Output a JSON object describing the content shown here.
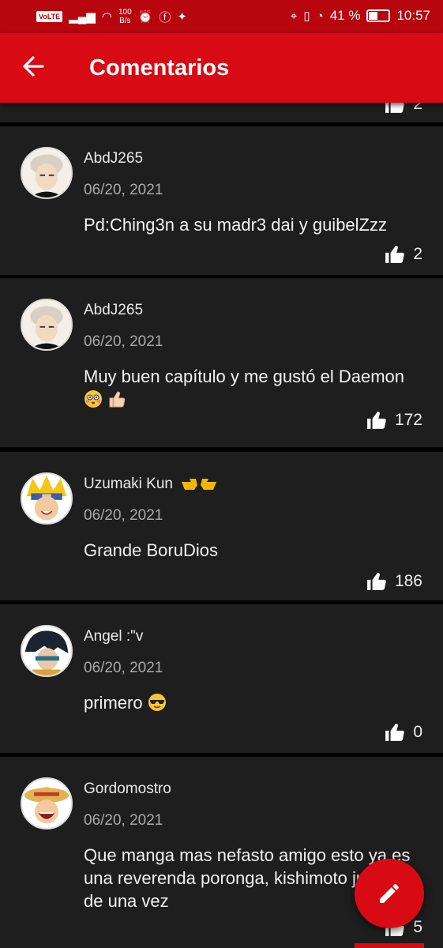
{
  "status_bar": {
    "volte": "VoLTE",
    "net_speed": "100",
    "net_unit": "B/s",
    "battery": "41 %",
    "battery_level": 0.41,
    "time": "10:57"
  },
  "app_bar": {
    "title": "Comentarios"
  },
  "partial_top": {
    "likes": "2"
  },
  "comments": [
    {
      "user": "AbdJ265",
      "date": "06/20, 2021",
      "text": "Pd:Ching3n a su madr3 dai y guibelZzz",
      "likes": "2"
    },
    {
      "user": "AbdJ265",
      "date": "06/20, 2021",
      "text": "Muy buen capítulo y me gustó el Daemon",
      "emojis": [
        "flushed-face",
        "thumbs-up"
      ],
      "likes": "172"
    },
    {
      "user": "Uzumaki Kun",
      "user_emoji": "pointing-hands",
      "date": "06/20, 2021",
      "text": "Grande BoruDios",
      "likes": "186"
    },
    {
      "user": "Angel :\"v",
      "date": "06/20, 2021",
      "text": "primero",
      "emojis": [
        "sunglasses-face"
      ],
      "likes": "0"
    },
    {
      "user": "Gordomostro",
      "date": "06/20, 2021",
      "text": "Que manga mas nefasto amigo esto ya es una reverenda poronga, kishimoto jubilate de una vez",
      "likes": "5"
    }
  ],
  "fab": {
    "icon": "pencil-icon"
  },
  "colors": {
    "primary": "#d80a13",
    "status_bar": "#b7060e",
    "card": "#1e1e1e",
    "background": "#000000"
  }
}
